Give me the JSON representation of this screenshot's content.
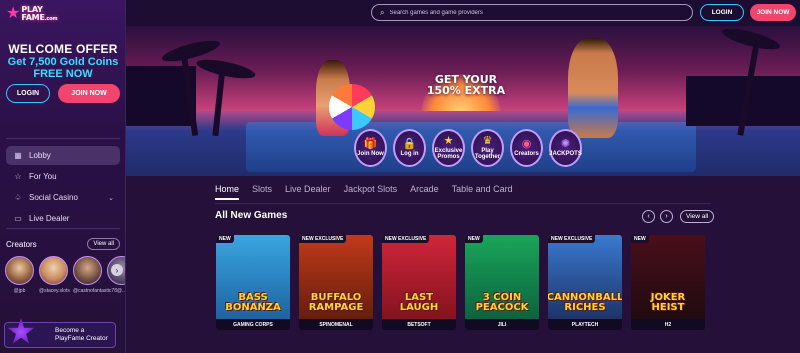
{
  "logo": {
    "text_line1": "PLAY",
    "text_line2": "FAME",
    "suffix": ".com"
  },
  "topbar": {
    "search_placeholder": "Search games and game providers",
    "login_label": "LOGIN",
    "join_label": "JOIN NOW"
  },
  "sidebar": {
    "welcome_title": "WELCOME OFFER",
    "welcome_line1": "Get 7,500 Gold Coins",
    "welcome_line2": "FREE NOW",
    "login_label": "LOGIN",
    "join_label": "JOIN NOW",
    "nav": [
      {
        "label": "Lobby",
        "icon": "lobby-icon"
      },
      {
        "label": "For You",
        "icon": "star-icon"
      },
      {
        "label": "Social Casino",
        "icon": "cards-icon"
      },
      {
        "label": "Live Dealer",
        "icon": "dealer-icon"
      }
    ],
    "creators_title": "Creators",
    "creators_view_all": "View all",
    "creators": [
      {
        "name": "@jpb"
      },
      {
        "name": "@stacey.slots"
      },
      {
        "name": "@castnofantastic78"
      },
      {
        "name": "@..."
      }
    ],
    "become_creator_line1": "Become a",
    "become_creator_line2": "PlayFame Creator"
  },
  "hero": {
    "title_line1": "GET YOUR",
    "title_line2": "150% EXTRA",
    "icons": [
      {
        "label": "Join Now",
        "icon": "gift-icon",
        "color": "#ffd23a"
      },
      {
        "label": "Log in",
        "icon": "lock-icon",
        "color": "#ffa23a"
      },
      {
        "label": "Exclusive Promos",
        "icon": "promo-icon",
        "color": "#ffd23a"
      },
      {
        "label": "Play Together",
        "icon": "users-icon",
        "color": "#ffd23a"
      },
      {
        "label": "Creators",
        "icon": "creators-icon",
        "color": "#ff5a8a"
      },
      {
        "label": "JACKPOTS",
        "icon": "wheel-icon",
        "color": "#c58cff"
      }
    ]
  },
  "main": {
    "tabs": [
      "Home",
      "Slots",
      "Live Dealer",
      "Jackpot Slots",
      "Arcade",
      "Table and Card"
    ],
    "active_tab": "Home",
    "section_title": "All New Games",
    "view_all": "View all",
    "games": [
      {
        "title": "BASS BONANZA",
        "badge": "NEW",
        "provider": "GAMING CORPS",
        "bg": "#3aa6e0",
        "accent": "#1a5a9a"
      },
      {
        "title": "BUFFALO RAMPAGE",
        "badge": "NEW EXCLUSIVE",
        "provider": "SPINOMENAL",
        "bg": "#c23a1a",
        "accent": "#5a1a0a"
      },
      {
        "title": "LAST LAUGH",
        "badge": "NEW EXCLUSIVE",
        "provider": "BETSOFT",
        "bg": "#d0263a",
        "accent": "#7a0f1a"
      },
      {
        "title": "3 COIN PEACOCK",
        "badge": "NEW",
        "provider": "JILI",
        "bg": "#1aa65a",
        "accent": "#0a5a3a"
      },
      {
        "title": "CANNONBALL RICHES",
        "badge": "NEW EXCLUSIVE",
        "provider": "PLAYTECH",
        "bg": "#3a7ad0",
        "accent": "#1a2a5a"
      },
      {
        "title": "JOKER HEIST",
        "badge": "NEW",
        "provider": "H2",
        "bg": "#4a0f1a",
        "accent": "#1a0a0f"
      }
    ]
  }
}
